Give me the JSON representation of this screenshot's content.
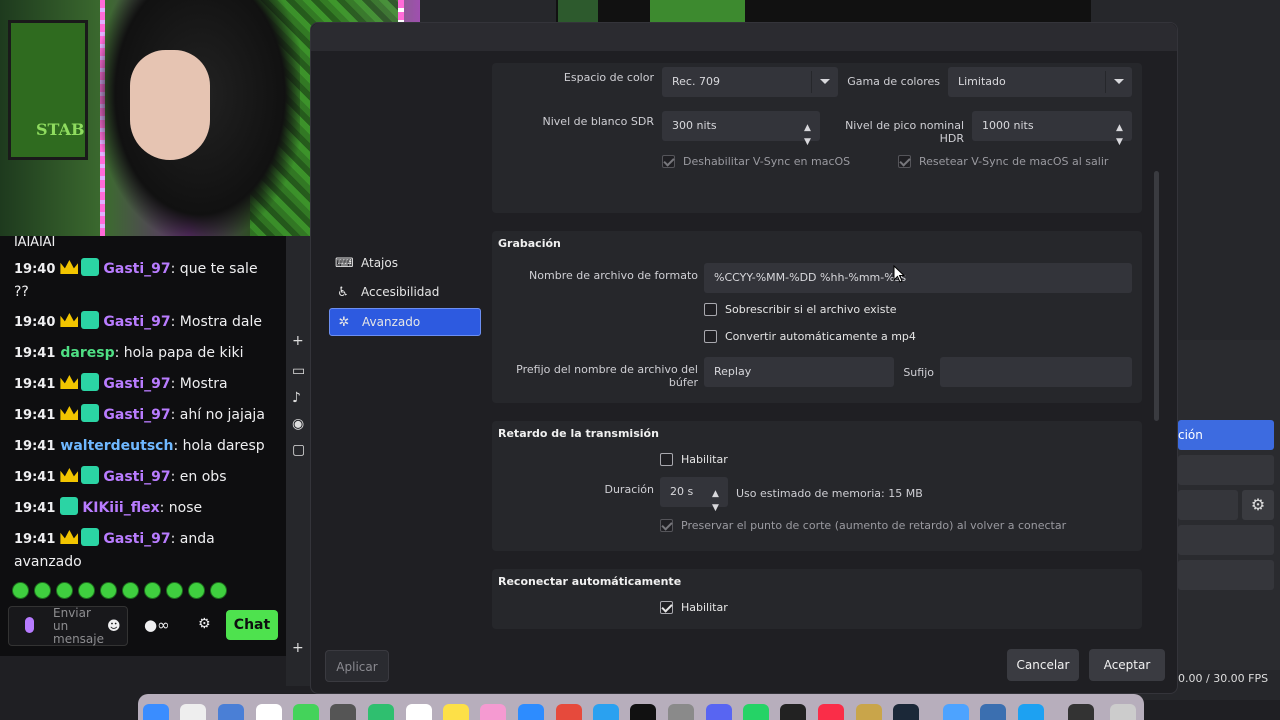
{
  "webcam": {
    "poster_text": "STAB"
  },
  "chat": {
    "cutoff_text": "JAJAJAJ",
    "messages": [
      {
        "time": "19:40",
        "badges": [
          "crown",
          "sub"
        ],
        "user": "Gasti_97",
        "user_color": "#b97cff",
        "text": ": que te sale ??"
      },
      {
        "time": "19:40",
        "badges": [
          "crown",
          "sub"
        ],
        "user": "Gasti_97",
        "user_color": "#b97cff",
        "text": ": Mostra dale"
      },
      {
        "time": "19:41",
        "badges": [],
        "user": "daresp",
        "user_color": "#4fdf84",
        "text": ": hola papa de kiki"
      },
      {
        "time": "19:41",
        "badges": [
          "crown",
          "sub"
        ],
        "user": "Gasti_97",
        "user_color": "#b97cff",
        "text": ": Mostra"
      },
      {
        "time": "19:41",
        "badges": [
          "crown",
          "sub"
        ],
        "user": "Gasti_97",
        "user_color": "#b97cff",
        "text": ": ahí no jajaja"
      },
      {
        "time": "19:41",
        "badges": [],
        "user": "walterdeutsch",
        "user_color": "#6fb8ff",
        "text": ": hola daresp"
      },
      {
        "time": "19:41",
        "badges": [
          "crown",
          "sub"
        ],
        "user": "Gasti_97",
        "user_color": "#b97cff",
        "text": ": en obs"
      },
      {
        "time": "19:41",
        "badges": [
          "sub"
        ],
        "user": "KIKiii_flex",
        "user_color": "#b97cff",
        "text": ": nose"
      },
      {
        "time": "19:41",
        "badges": [
          "crown",
          "sub"
        ],
        "user": "Gasti_97",
        "user_color": "#b97cff",
        "text": ": anda avanzado"
      }
    ],
    "input_placeholder": "Enviar un mensaje",
    "infinity_label": "∞",
    "chat_button": "Chat"
  },
  "settings": {
    "nav": [
      {
        "label": "Atajos",
        "icon": "keyboard-icon",
        "glyph": "⌨"
      },
      {
        "label": "Accesibilidad",
        "icon": "accessibility-icon",
        "glyph": "♿"
      },
      {
        "label": "Avanzado",
        "icon": "wrench-icon",
        "glyph": "✲"
      }
    ],
    "video": {
      "color_space_label": "Espacio de color",
      "color_space_value": "Rec. 709",
      "color_range_label": "Gama de colores",
      "color_range_value": "Limitado",
      "sdr_white_label": "Nivel de blanco SDR",
      "sdr_white_value": "300 nits",
      "hdr_peak_label": "Nivel de pico nominal HDR",
      "hdr_peak_value": "1000 nits",
      "disable_vsync_label": "Deshabilitar V-Sync en macOS",
      "disable_vsync_checked": true,
      "reset_vsync_label": "Resetear V-Sync de macOS al salir",
      "reset_vsync_checked": true
    },
    "recording": {
      "title": "Grabación",
      "filename_format_label": "Nombre de archivo de formato",
      "filename_format_value": "%CCYY-%MM-%DD %hh-%mm-%ss",
      "overwrite_label": "Sobrescribir si el archivo existe",
      "overwrite_checked": false,
      "remux_label": "Convertir automáticamente a mp4",
      "remux_checked": false,
      "buffer_prefix_label": "Prefijo del nombre de archivo del búfer",
      "buffer_prefix_value": "Replay",
      "suffix_label": "Sufijo",
      "suffix_value": ""
    },
    "stream_delay": {
      "title": "Retardo de la transmisión",
      "enable_label": "Habilitar",
      "enable_checked": false,
      "duration_label": "Duración",
      "duration_value": "20 s",
      "memory_usage": "Uso estimado de memoria: 15 MB",
      "preserve_label": "Preservar el punto de corte (aumento de retardo) al volver a conectar",
      "preserve_checked": true
    },
    "reconnect": {
      "title": "Reconectar automáticamente",
      "enable_label": "Habilitar",
      "enable_checked": true
    },
    "buttons": {
      "apply": "Aplicar",
      "cancel": "Cancelar",
      "accept": "Aceptar"
    }
  },
  "background": {
    "active_button_partial": "ción",
    "fps_status": "0.00 / 30.00 FPS"
  }
}
